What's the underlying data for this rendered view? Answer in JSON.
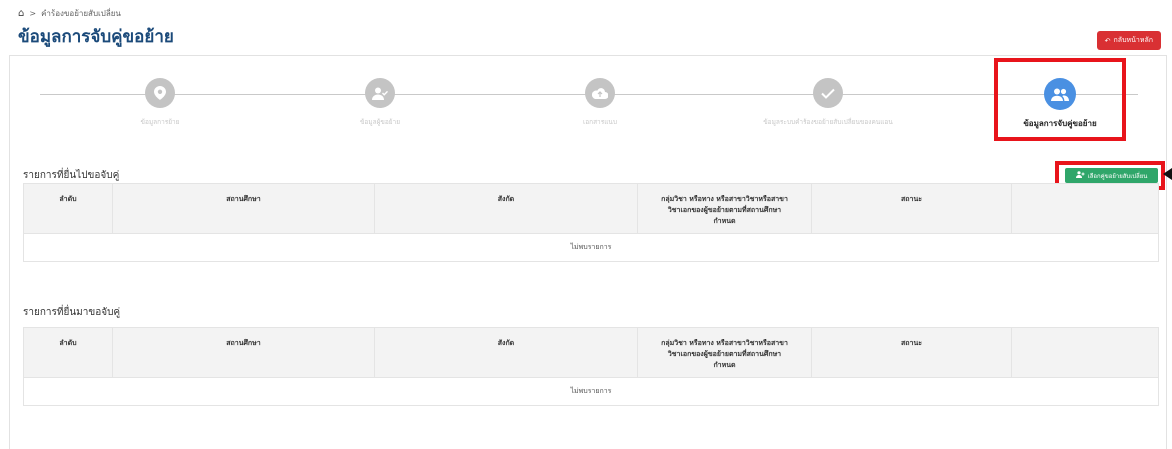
{
  "breadcrumb": {
    "home_icon": "home-icon",
    "separator": ">",
    "current": "คำร้องขอย้ายสับเปลี่ยน"
  },
  "page": {
    "title": "ข้อมูลการจับคู่ขอย้าย"
  },
  "back_button": {
    "label": "กลับหน้าหลัก",
    "icon": "undo-icon",
    "color": "#d93033"
  },
  "stepper": {
    "steps": [
      {
        "label": "ข้อมูลการย้าย",
        "icon": "map-pin-icon",
        "active": false
      },
      {
        "label": "ข้อมูลผู้ขอย้าย",
        "icon": "user-check-icon",
        "active": false
      },
      {
        "label": "เอกสารแนบ",
        "icon": "cloud-upload-icon",
        "active": false
      },
      {
        "label": "ข้อมูลระบบคำร้องขอย้ายสับเปลี่ยนของคนแอน",
        "icon": "check-icon",
        "active": false
      },
      {
        "label": "ข้อมูลการจับคู่ขอย้าย",
        "icon": "users-icon",
        "active": true
      }
    ],
    "active_color": "#4a90e2",
    "inactive_color": "#c4c4c4"
  },
  "select_swap_button": {
    "label": "เลือกคู่ขอย้ายสับเปลี่ยน",
    "icon": "user-plus-icon",
    "color": "#2fa66a"
  },
  "highlight_color": "#e8141b",
  "tables": [
    {
      "title": "รายการที่ยื่นไปขอจับคู่",
      "columns": [
        "ลำดับ",
        "สถานศึกษา",
        "สังกัด",
        "กลุ่มวิชา หรือทาง หรือสาขาวิชาหรือสาขา\nวิชาเอกของผู้ขอย้ายตามที่สถานศึกษา\nกำหนด",
        "สถานะ",
        ""
      ],
      "empty_text": "ไม่พบรายการ"
    },
    {
      "title": "รายการที่ยื่นมาขอจับคู่",
      "columns": [
        "ลำดับ",
        "สถานศึกษา",
        "สังกัด",
        "กลุ่มวิชา หรือทาง หรือสาขาวิชาหรือสาขา\nวิชาเอกของผู้ขอย้ายตามที่สถานศึกษา\nกำหนด",
        "สถานะ",
        ""
      ],
      "empty_text": "ไม่พบรายการ"
    }
  ]
}
